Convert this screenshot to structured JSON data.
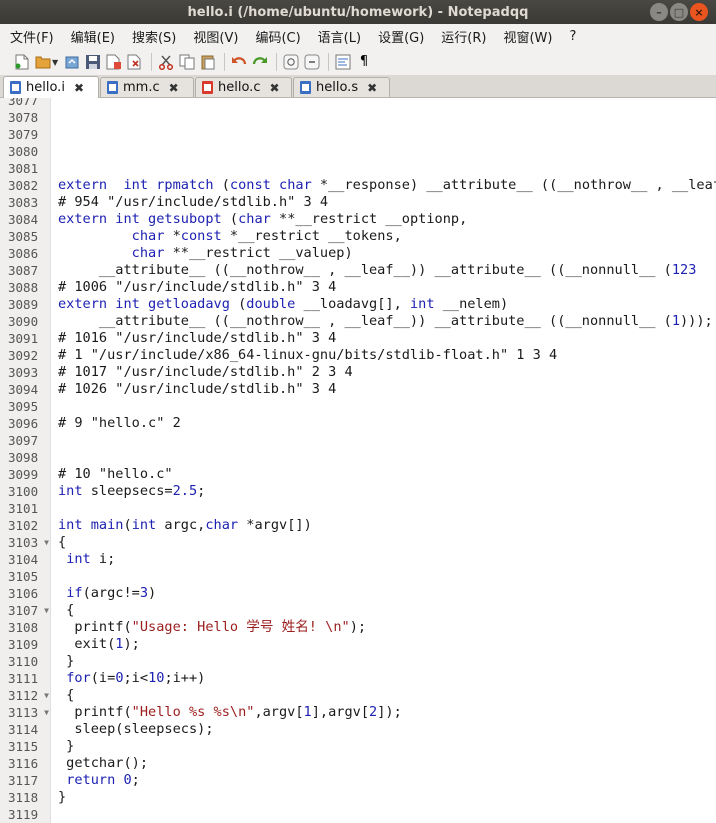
{
  "window": {
    "title": "hello.i (/home/ubuntu/homework) - Notepadqq"
  },
  "menu": [
    "文件(F)",
    "编辑(E)",
    "搜索(S)",
    "视图(V)",
    "编码(C)",
    "语言(L)",
    "设置(G)",
    "运行(R)",
    "视窗(W)",
    "?"
  ],
  "toolbar": {
    "icons": [
      "new-file-icon",
      "open-folder-icon",
      "reload-icon",
      "save-icon",
      "save-all-icon",
      "close-file-icon",
      "cut-icon",
      "copy-icon",
      "paste-icon",
      "undo-icon",
      "redo-icon",
      "zoom-in-icon",
      "zoom-out-icon",
      "word-wrap-icon",
      "show-all-chars-icon"
    ],
    "pilcrow": "¶"
  },
  "tabs": [
    {
      "label": "hello.i",
      "active": true,
      "icon_color": "#3b6fc4"
    },
    {
      "label": "mm.c",
      "active": false,
      "icon_color": "#3b6fc4"
    },
    {
      "label": "hello.c",
      "active": false,
      "icon_color": "#d83b2b"
    },
    {
      "label": "hello.s",
      "active": false,
      "icon_color": "#3b6fc4"
    }
  ],
  "tab_close_glyph": "✖",
  "editor": {
    "lines": [
      {
        "n": "3077",
        "fold": false,
        "segs": []
      },
      {
        "n": "3078",
        "fold": false,
        "segs": []
      },
      {
        "n": "3079",
        "fold": false,
        "segs": []
      },
      {
        "n": "3080",
        "fold": false,
        "segs": []
      },
      {
        "n": "3081",
        "fold": false,
        "segs": []
      },
      {
        "n": "3082",
        "fold": false,
        "segs": [
          [
            "kw",
            "extern"
          ],
          [
            "",
            "  "
          ],
          [
            "ty",
            "int"
          ],
          [
            "",
            " "
          ],
          [
            "fn",
            "rpmatch"
          ],
          [
            "",
            " ("
          ],
          [
            "ty",
            "const char"
          ],
          [
            "",
            " *__response) __attribute__ ((__nothrow__ , __leaf__"
          ]
        ]
      },
      {
        "n": "3083",
        "fold": false,
        "segs": [
          [
            "",
            "# 954 \"/usr/include/stdlib.h\" 3 4"
          ]
        ]
      },
      {
        "n": "3084",
        "fold": false,
        "segs": [
          [
            "kw",
            "extern"
          ],
          [
            "",
            " "
          ],
          [
            "ty",
            "int"
          ],
          [
            "",
            " "
          ],
          [
            "fn",
            "getsubopt"
          ],
          [
            "",
            " ("
          ],
          [
            "ty",
            "char"
          ],
          [
            "",
            " **__restrict __optionp,"
          ]
        ]
      },
      {
        "n": "3085",
        "fold": false,
        "segs": [
          [
            "",
            "         "
          ],
          [
            "ty",
            "char"
          ],
          [
            "",
            " *"
          ],
          [
            "ty",
            "const"
          ],
          [
            "",
            " *__restrict __tokens,"
          ]
        ]
      },
      {
        "n": "3086",
        "fold": false,
        "segs": [
          [
            "",
            "         "
          ],
          [
            "ty",
            "char"
          ],
          [
            "",
            " **__restrict __valuep)"
          ]
        ]
      },
      {
        "n": "3087",
        "fold": false,
        "segs": [
          [
            "",
            "     __attribute__ ((__nothrow__ , __leaf__)) __attribute__ ((__nonnull__ ("
          ],
          [
            "num",
            "1"
          ],
          [
            ", "
          ],
          [
            "num",
            "2"
          ],
          [
            ", "
          ],
          [
            "num",
            "3"
          ]
        ]
      },
      {
        "n": "3088",
        "fold": false,
        "segs": [
          [
            "",
            "# 1006 \"/usr/include/stdlib.h\" 3 4"
          ]
        ]
      },
      {
        "n": "3089",
        "fold": false,
        "segs": [
          [
            "kw",
            "extern"
          ],
          [
            "",
            " "
          ],
          [
            "ty",
            "int"
          ],
          [
            "",
            " "
          ],
          [
            "fn",
            "getloadavg"
          ],
          [
            "",
            " ("
          ],
          [
            "ty",
            "double"
          ],
          [
            "",
            " __loadavg[], "
          ],
          [
            "ty",
            "int"
          ],
          [
            "",
            " __nelem)"
          ]
        ]
      },
      {
        "n": "3090",
        "fold": false,
        "segs": [
          [
            "",
            "     __attribute__ ((__nothrow__ , __leaf__)) __attribute__ ((__nonnull__ ("
          ],
          [
            "num",
            "1"
          ],
          [
            "",
            ")));"
          ]
        ]
      },
      {
        "n": "3091",
        "fold": false,
        "segs": [
          [
            "",
            "# 1016 \"/usr/include/stdlib.h\" 3 4"
          ]
        ]
      },
      {
        "n": "3092",
        "fold": false,
        "segs": [
          [
            "",
            "# 1 \"/usr/include/x86_64-linux-gnu/bits/stdlib-float.h\" 1 3 4"
          ]
        ]
      },
      {
        "n": "3093",
        "fold": false,
        "segs": [
          [
            "",
            "# 1017 \"/usr/include/stdlib.h\" 2 3 4"
          ]
        ]
      },
      {
        "n": "3094",
        "fold": false,
        "segs": [
          [
            "",
            "# 1026 \"/usr/include/stdlib.h\" 3 4"
          ]
        ]
      },
      {
        "n": "3095",
        "fold": false,
        "segs": []
      },
      {
        "n": "3096",
        "fold": false,
        "segs": [
          [
            "",
            "# 9 \"hello.c\" 2"
          ]
        ]
      },
      {
        "n": "3097",
        "fold": false,
        "segs": []
      },
      {
        "n": "3098",
        "fold": false,
        "segs": []
      },
      {
        "n": "3099",
        "fold": false,
        "segs": [
          [
            "",
            "# 10 \"hello.c\""
          ]
        ]
      },
      {
        "n": "3100",
        "fold": false,
        "segs": [
          [
            "ty",
            "int"
          ],
          [
            "",
            " sleepsecs="
          ],
          [
            "num",
            "2.5"
          ],
          [
            "",
            ";"
          ]
        ]
      },
      {
        "n": "3101",
        "fold": false,
        "segs": []
      },
      {
        "n": "3102",
        "fold": false,
        "segs": [
          [
            "ty",
            "int"
          ],
          [
            "",
            " "
          ],
          [
            "fn",
            "main"
          ],
          [
            "",
            "("
          ],
          [
            "ty",
            "int"
          ],
          [
            "",
            " argc,"
          ],
          [
            "ty",
            "char"
          ],
          [
            "",
            " *argv[])"
          ]
        ]
      },
      {
        "n": "3103",
        "fold": true,
        "segs": [
          [
            "",
            "{"
          ]
        ]
      },
      {
        "n": "3104",
        "fold": false,
        "segs": [
          [
            "",
            " "
          ],
          [
            "ty",
            "int"
          ],
          [
            "",
            " i;"
          ]
        ]
      },
      {
        "n": "3105",
        "fold": false,
        "segs": []
      },
      {
        "n": "3106",
        "fold": false,
        "segs": [
          [
            "",
            " "
          ],
          [
            "kw",
            "if"
          ],
          [
            "",
            "(argc!="
          ],
          [
            "num",
            "3"
          ],
          [
            "",
            ")"
          ]
        ]
      },
      {
        "n": "3107",
        "fold": true,
        "segs": [
          [
            "",
            " {"
          ]
        ]
      },
      {
        "n": "3108",
        "fold": false,
        "segs": [
          [
            "",
            "  printf("
          ],
          [
            "str",
            "\"Usage: Hello 学号 姓名! \\n\""
          ],
          [
            "",
            ");"
          ]
        ]
      },
      {
        "n": "3109",
        "fold": false,
        "segs": [
          [
            "",
            "  exit("
          ],
          [
            "num",
            "1"
          ],
          [
            "",
            ");"
          ]
        ]
      },
      {
        "n": "3110",
        "fold": false,
        "segs": [
          [
            "",
            " }"
          ]
        ]
      },
      {
        "n": "3111",
        "fold": false,
        "segs": [
          [
            "",
            " "
          ],
          [
            "kw",
            "for"
          ],
          [
            "",
            "(i="
          ],
          [
            "num",
            "0"
          ],
          [
            "",
            ";i<"
          ],
          [
            "num",
            "10"
          ],
          [
            "",
            ";i++)"
          ]
        ]
      },
      {
        "n": "3112",
        "fold": true,
        "segs": [
          [
            "",
            " {"
          ]
        ]
      },
      {
        "n": "3113",
        "fold": true,
        "segs": [
          [
            "",
            "  printf("
          ],
          [
            "str",
            "\"Hello %s %s\\n\""
          ],
          [
            "",
            ",argv["
          ],
          [
            "num",
            "1"
          ],
          [
            "",
            "],argv["
          ],
          [
            "num",
            "2"
          ],
          [
            "",
            "]);"
          ]
        ]
      },
      {
        "n": "3114",
        "fold": false,
        "segs": [
          [
            "",
            "  sleep(sleepsecs);"
          ]
        ]
      },
      {
        "n": "3115",
        "fold": false,
        "segs": [
          [
            "",
            " }"
          ]
        ]
      },
      {
        "n": "3116",
        "fold": false,
        "segs": [
          [
            "",
            " getchar();"
          ]
        ]
      },
      {
        "n": "3117",
        "fold": false,
        "segs": [
          [
            "",
            " "
          ],
          [
            "kw",
            "return"
          ],
          [
            "",
            " "
          ],
          [
            "num",
            "0"
          ],
          [
            "",
            ";"
          ]
        ]
      },
      {
        "n": "3118",
        "fold": false,
        "segs": [
          [
            "",
            "}"
          ]
        ]
      },
      {
        "n": "3119",
        "fold": false,
        "segs": []
      }
    ]
  },
  "watermark": ""
}
